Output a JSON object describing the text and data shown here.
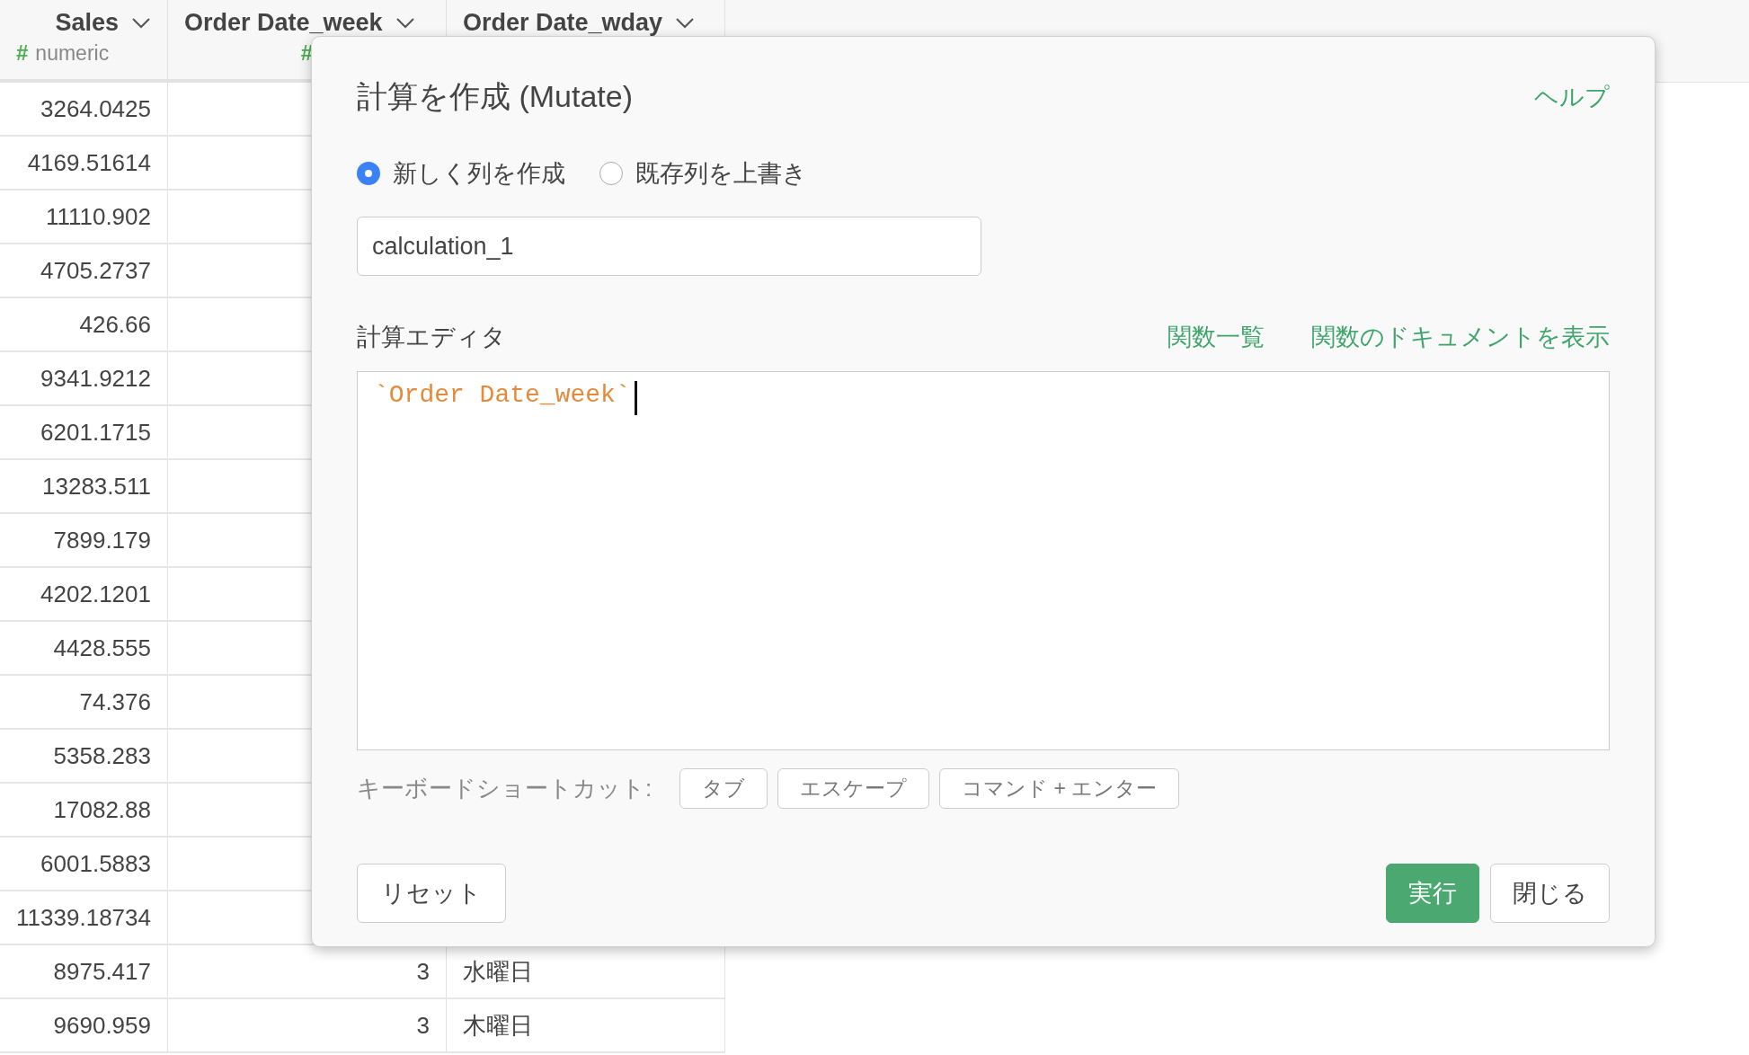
{
  "table": {
    "columns": [
      {
        "name": "Sales",
        "type_icon": "#",
        "type": "numeric"
      },
      {
        "name": "Order Date_week",
        "type_icon": "#"
      },
      {
        "name": "Order Date_wday"
      }
    ],
    "rows": [
      {
        "sales": "3264.0425"
      },
      {
        "sales": "4169.51614"
      },
      {
        "sales": "11110.902"
      },
      {
        "sales": "4705.2737"
      },
      {
        "sales": "426.66"
      },
      {
        "sales": "9341.9212"
      },
      {
        "sales": "6201.1715"
      },
      {
        "sales": "13283.511"
      },
      {
        "sales": "7899.179"
      },
      {
        "sales": "4202.1201"
      },
      {
        "sales": "4428.555"
      },
      {
        "sales": "74.376"
      },
      {
        "sales": "5358.283"
      },
      {
        "sales": "17082.88"
      },
      {
        "sales": "6001.5883"
      },
      {
        "sales": "11339.18734"
      },
      {
        "sales": "8975.417",
        "week": "3",
        "wday": "水曜日"
      },
      {
        "sales": "9690.959",
        "week": "3",
        "wday": "木曜日"
      }
    ]
  },
  "dialog": {
    "title": "計算を作成 (Mutate)",
    "help": "ヘルプ",
    "modes": [
      {
        "label": "新しく列を作成",
        "selected": true
      },
      {
        "label": "既存列を上書き",
        "selected": false
      }
    ],
    "column_name": "calculation_1",
    "editor_label": "計算エディタ",
    "editor_links": [
      "関数一覧",
      "関数のドキュメントを表示"
    ],
    "editor_code": "`Order Date_week`",
    "shortcuts_label": "キーボードショートカット:",
    "shortcuts": [
      "タブ",
      "エスケープ",
      "コマンド + エンター"
    ],
    "buttons": [
      {
        "label": "リセット",
        "kind": "secondary"
      },
      {
        "label": "実行",
        "kind": "primary"
      },
      {
        "label": "閉じる",
        "kind": "secondary"
      }
    ]
  }
}
